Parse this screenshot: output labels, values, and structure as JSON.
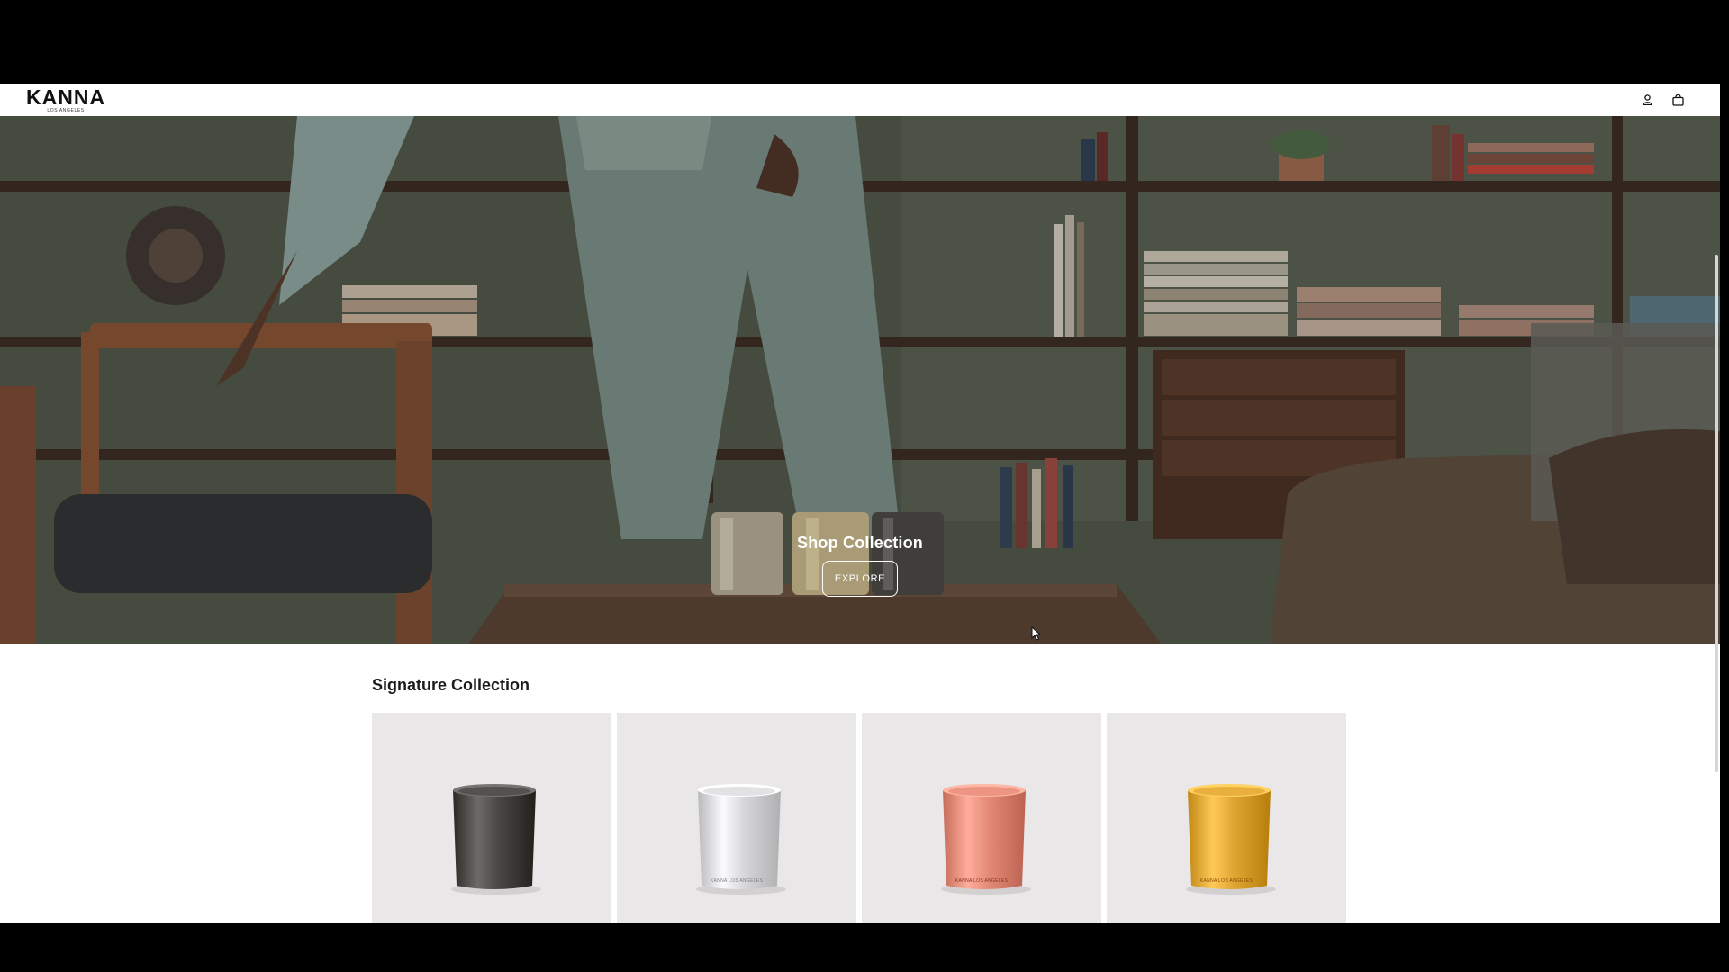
{
  "header": {
    "logo_main": "KANNA",
    "logo_sub": "LOS ANGELES",
    "icons": [
      "user-icon",
      "shopping-bag-icon"
    ]
  },
  "hero": {
    "title": "Shop Collection",
    "button_label": "EXPLORE"
  },
  "collection": {
    "title": "Signature Collection",
    "products": [
      {
        "name": "candle-gunmetal",
        "color": "#4a4744",
        "label": ""
      },
      {
        "name": "candle-silver",
        "color": "#d8d8da",
        "label": "KANNA LOS ANGELES"
      },
      {
        "name": "candle-rose-gold",
        "color": "#e48a78",
        "label": "KANNA LOS ANGELES"
      },
      {
        "name": "candle-gold",
        "color": "#e0a634",
        "label": "KANNA LOS ANGELES"
      }
    ]
  },
  "colors": {
    "frame": "#000000",
    "page": "#ffffff",
    "card": "#e9e7e8"
  }
}
